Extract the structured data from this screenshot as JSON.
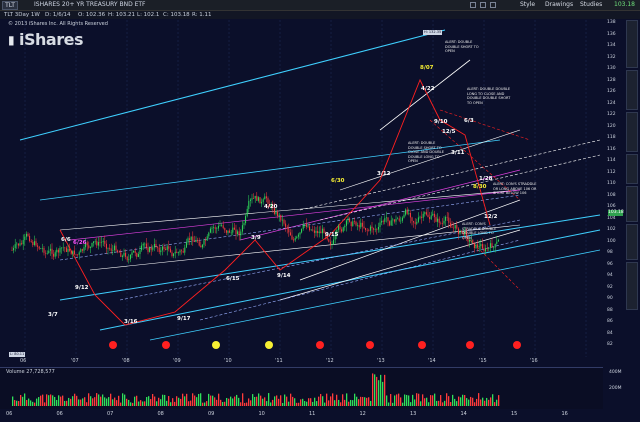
{
  "window": {
    "symbol": "TLT",
    "title": "ISHARES 20+ YR TREASURY BND ETF",
    "toolbar": {
      "style": "Style",
      "drawings": "Drawings",
      "studies": "Studies",
      "last": "103.18"
    }
  },
  "quote": {
    "interval": "TLT 3Day 1W",
    "date": "D: 1/6/14",
    "open": "O: 102.36",
    "high": "H: 103.21",
    "low": "L: 102.1",
    "close": "C: 103.18",
    "change": "R: 1.11"
  },
  "copyright": "© 2013 iShares Inc. All Rights Reserved",
  "logo": {
    "text": "iShares"
  },
  "price_axis": {
    "labels": [
      "138",
      "136",
      "134",
      "132",
      "130",
      "128",
      "126",
      "124",
      "122",
      "120",
      "118",
      "116",
      "114",
      "112",
      "110",
      "108",
      "106",
      "104",
      "102",
      "100",
      "98",
      "96",
      "94",
      "92",
      "90",
      "88",
      "86",
      "84",
      "82"
    ],
    "last_price": "103.18"
  },
  "time_axis": {
    "labels": [
      "06",
      "'07",
      "'08",
      "'09",
      "'10",
      "'11",
      "'12",
      "'13",
      "'14",
      "'15",
      "'16"
    ]
  },
  "volume": {
    "label": "Volume",
    "value": "27,728,577",
    "scale": [
      "400M",
      "200M"
    ]
  },
  "bottom_axis": {
    "labels": [
      "06",
      "06",
      "07",
      "08",
      "09",
      "10",
      "11",
      "12",
      "13",
      "14",
      "15",
      "16"
    ]
  },
  "annotations": {
    "a_1": "6/6",
    "a_2": "6/26",
    "a_3": "9/12",
    "a_4": "3/7",
    "a_5": "3/16",
    "a_6": "9/17",
    "a_7": "6/15",
    "a_8": "3/9",
    "a_9": "4/20",
    "a_10": "9/14",
    "a_11": "6/30",
    "a_12": "9/15",
    "a_13": "3/12",
    "a_14": "8/07",
    "a_15": "4/22",
    "a_16": "9/10",
    "a_17": "6/3",
    "a_18": "3/11",
    "a_19": "12/2",
    "a_20": "8/30",
    "a_21": "1/28",
    "a_22": "12/5"
  },
  "alerts": {
    "al_1": "ALERT: DOUBLE DOUBLE SHORT TO OPEN",
    "al_2": "ALERT: DOUBLE DOUBLE LONG TO CLOSE AND DOUBLE DOUBLE SHORT TO OPEN",
    "al_3": "ALERT: DOUBLE DOUBLE SHORT TO CLOSE AND DOUBLE DOUBLE LONG TO OPEN",
    "al_4": "ALERT: CON'S STRADDLE OR LONG ABOVE 106 OR SHORT BELOW 106",
    "al_5": "ALERT: CON'S STRADDLE DOUBLE DOUBLE LONG TO OPEN"
  },
  "high_marker": "H: 132.35",
  "low_marker": "L: 80.11",
  "colors": {
    "background": "#0b0f2a",
    "cyan": "#3fd0ff",
    "magenta": "#e040e0",
    "red": "#ff2020",
    "yellow": "#f7ef33",
    "candle_up": "#2fe05a",
    "candle_down": "#ff3b3b"
  }
}
